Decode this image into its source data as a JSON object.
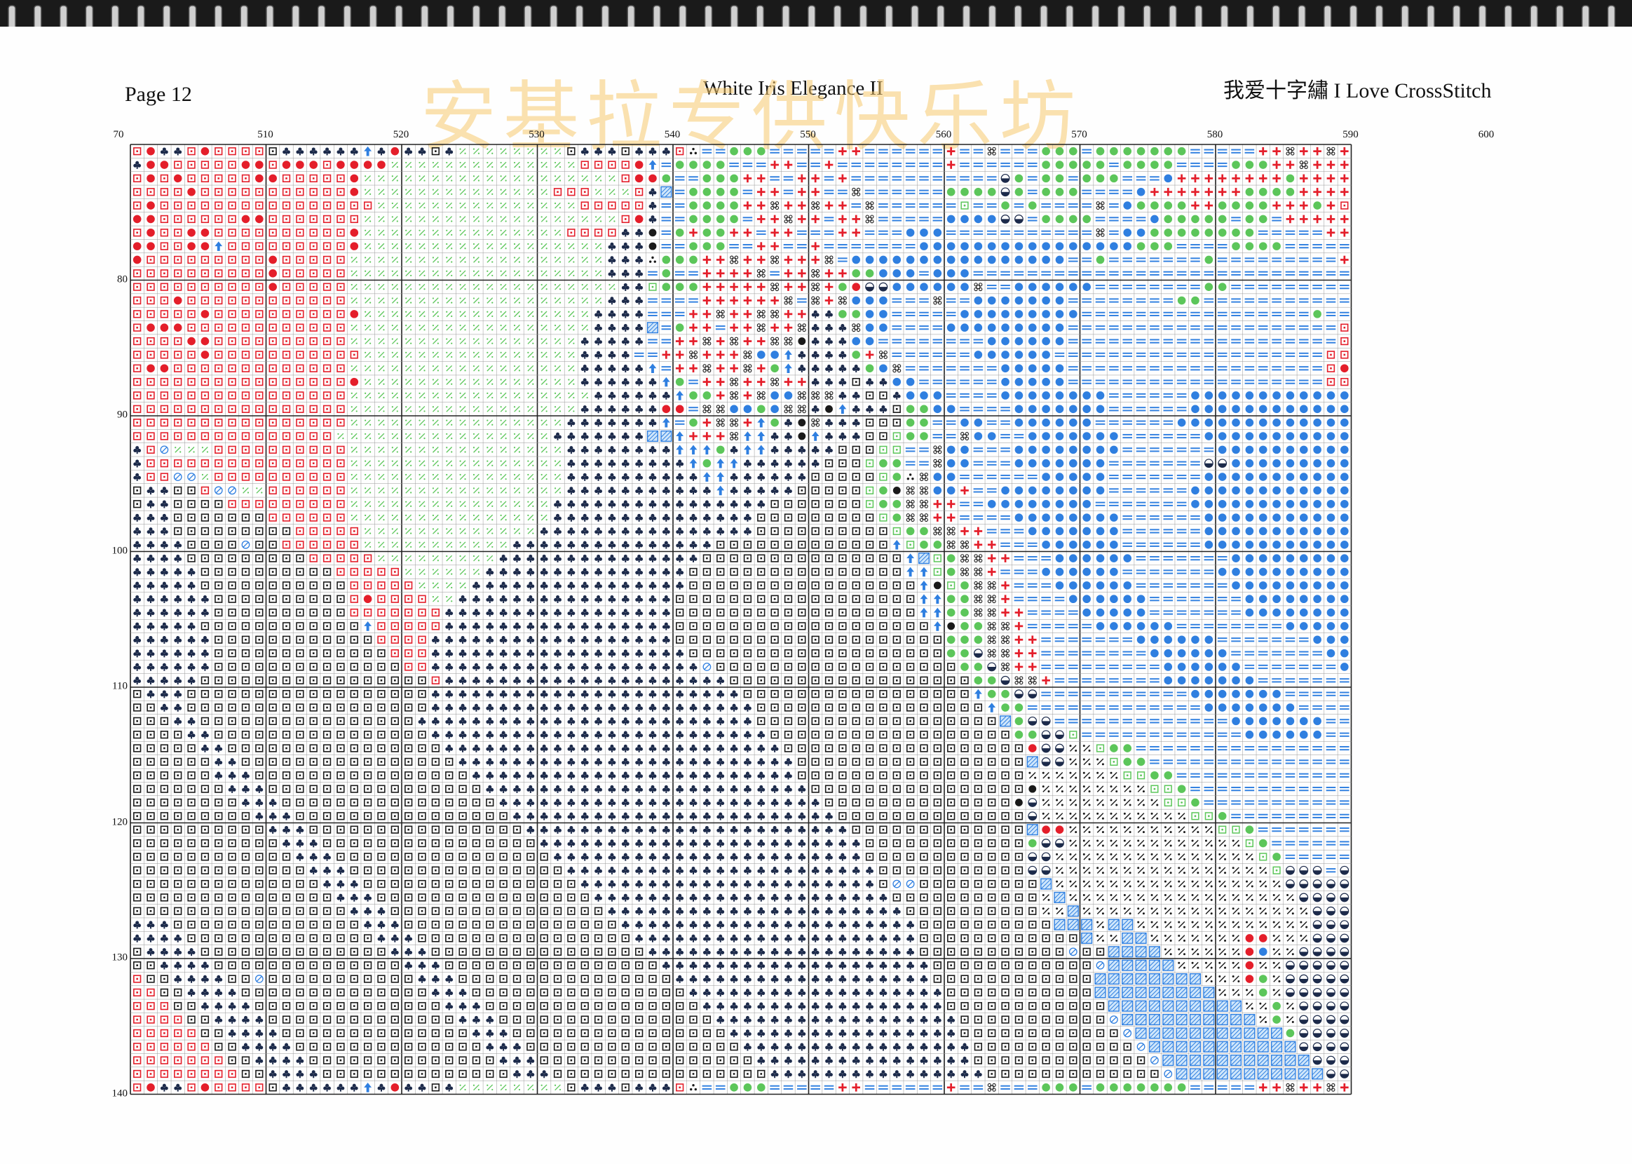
{
  "header": {
    "page_number": "Page 12",
    "title": "White Iris Elegance II",
    "publisher": "我爱十字繡 I Love CrossStitch",
    "watermark": "安基拉专供快乐坊"
  },
  "column_labels": [
    "70",
    "510",
    "520",
    "530",
    "540",
    "550",
    "560",
    "570",
    "580",
    "590",
    "600"
  ],
  "row_labels": [
    "80",
    "90",
    "100",
    "110",
    "120",
    "130",
    "140"
  ],
  "colors": {
    "red": "#e41e2a",
    "green": "#5cc65a",
    "blue": "#2f7fe0",
    "black": "#1a1a1a",
    "navy": "#1c2a4a",
    "grid_line": "#9a9a9a",
    "major_line": "#222222"
  },
  "symbol_legend": [
    {
      "code": "R",
      "icon": "red-square-dot-icon"
    },
    {
      "code": "O",
      "icon": "red-circle-icon"
    },
    {
      "code": "X",
      "icon": "green-diagonal-icon"
    },
    {
      "code": "G",
      "icon": "green-circle-icon"
    },
    {
      "code": "Q",
      "icon": "green-square-dot-icon"
    },
    {
      "code": "E",
      "icon": "blue-double-bar-icon"
    },
    {
      "code": "P",
      "icon": "red-plus-icon"
    },
    {
      "code": "K",
      "icon": "black-loop-icon"
    },
    {
      "code": "B",
      "icon": "blue-circle-icon"
    },
    {
      "code": "H",
      "icon": "blue-half-circle-icon"
    },
    {
      "code": "C",
      "icon": "black-club-icon"
    },
    {
      "code": "S",
      "icon": "black-square-dot-icon"
    },
    {
      "code": "Z",
      "icon": "black-percent-icon"
    },
    {
      "code": "A",
      "icon": "blue-arrow-icon"
    },
    {
      "code": "D",
      "icon": "black-dot-icon"
    },
    {
      "code": "T",
      "icon": "black-triple-dot-icon"
    },
    {
      "code": "N",
      "icon": "blue-hatched-square-icon"
    },
    {
      "code": "U",
      "icon": "blue-no-symbol-icon"
    }
  ],
  "grid_rows": [
    "ROCCRORRRRSCCCCCCACOCCSCXXXXXXXXSCCCSCCCRTEEGGGEEEEEPPEEEEEEPEEKEEEGGGEGGGGGGGEEEEEPPKPPKP",
    "COORRRRROOROOOROOOOXXXXXXXXXXXXXXRRRROAEGGGGEEEPPEEPEEEEEEEEPEEEEEEGGGGGEGGGGEEEEGGGPPKPPP",
    "RORORRRRROORRRRROXXXXXXXXXXXXXXXXXXXROOGEEGGGPPEEPPEPEEEEEEEEEEEHGEGGEGGGEEEBPPPPPPPPGPPPP",
    "RRRRORRRRRRRRRRROXXXXXXXXXXXXXXRRRXXXRCNEGGGGEPPEPPEEKEEEEEEGGGGHGEGGGEEEEBPPPPPPPGGGGPPPP",
    "RORRRRRRRRRRRRRRRRXXXXXXXXXXXXXXXRRRRRCEEGGGGPPKPPKPPEKEEEEEEQEEGEGEEEEKEBGGGGPPGGGGPPPGP",
    "OORRRRRROORRRRRRRXXXXXXXXXXXXXXXXXXXROCEEGGGGEPPKPPEPPKEEEEEBBBBHHEGGGGEEEEBGGGGGEGGEPPPPPP",
    "RORROORRRRRRRRRROXXXXXXXXXXXXXXXRRRRCCDEGPGGPPEPPEEEPPEEEBBBEEEEEEEEEEEKEBBGGGGGGGGEEEEEPPP",
    "OORROOARRRRRRRRROXXXXXXXXXXXXXXXXXXCCCDEEGGGEEPPEEPEEEEEEEBBBBBBBBBBBBBBBBGGGEEEEGGGGEEEEE",
    "ORRRRRRRRRORRRRRXXXXXXXXXXXXXXXXXXXCCCTGGGPPKPPKPPPKEBBBBBBBBBBBBBBBBEEGEEEEEEEGEEEEEEEEEP",
    "RRRRRRRRRRORRRRRXXXXXXXXXXXXXXXXXXXCCCEGEEPPPPKEPPKPPGGBBBEBBBEEEEEEEEEEEEEEEEEEEEEEEEEEEE",
    "RRRRRRRRRRORRRRRXXXXXXXXXXXXXXXXXXXXCCQGGGPPPPPKPPKPGOHHBBBBBBKEEBBBBBBEEEEEEEEGGEEEEEEEEE",
    "RRRORRRRRRRRRRRRXXXXXXXXXXXXXXXXXXXCCCEEEEPPPPPPKEKPKBBBEEEKEEBBBBBBBEEEEEEEEGGEEEEEEEEEEE",
    "RRRRRORRRRRRRRRROXXXXXXXXXXXXXXXXXCCCCEEEPPKPPKKPPCCGGBBEEEEEBBBBBBBBBEEEEEEEEEEEEEEEEEGEE",
    "ROOORRRRRRRRRRRRXXXXXXXXXXXXXXXXXXCCCCNEGPPEPPKPPKCCCKBBEEEEBBBBBBBBBEEEEEEEEEEEEEEEEEEEE",
    "RRRROORRRRRRRRRRXXXXXXXXXXXXXXXXXCCCCCEEPPKPKPPKKDCCCBBEEEEEEEEBBBBBBEEEEEEEEEEEEEEEEEEEE",
    "RRRRRORRRRRRRRRRRXXXXXXXXXXXXXXXXCCCCEEPPKPPPKBBACCCCGPKEEEEEEBBBBBBEEEEEEEEEEEEEEEEEEEE",
    "ROORRRRRRRRRRRRRXXXXXXXXXXXXXXXXXCCCCCAEPPKPPKPGACCCCCGBKEEEEEEEBBBBBEEEEEEEEEEEEEEEEEEE",
    "RRRRRRRRRRRRRRRROXXXXXXXXXXXXXXXXCCCCCCAGEPPKPPKPPCCCSCCBBEEEEEEBBBBBEEEEEEEEEEEEEEEEEEE",
    "RRRRRRRRRRRRRRRRXXXXXXXXXXXXXXXXXXCCCCCCAGGPKPKBBKKKCCSSCBBBEEEEBBBBBBBBEEEEEEBBBBBBBBBBBB",
    "RRRRRRRRRRRRRRRRXXXXXXXXXXXXXXXXXCCCCCCOOEKKBBGBKKCDACCCSGGBBEEEEBBBBBBBEEEEEEBBBBBBBBBBBBB",
    "RRRRRRRRRRRRRRRRXXXXXXXXXXXXXXXXCCCCCCCAEGPKKPAGCDKCCCSSSGGEEBBEEBBBBBBEEEEEEBBBBBBBBBBBBB",
    "RRRRRRRRRRRRRRRXXXXXXXXXXXXXXXXCCCCCCCNNAPPPKAACCDACCCSSQGGEEKBBEEBBBBBBBEEEEEEBBBBBBBBBBBB",
    "CRUXXXRRRRRRRRRRXXXXXXXXXXXXXXXXCCCCCCCCAAAGCAACCCCCSSSQQEEKBBEEEBBBBBBBBEEEEEEEBBBBBBBBBBB",
    "CRRRRRRRRRRRRRRRXXXXXXXXXXXXXXXXCCCCCCCCCAGAACCCCCCSSSQGGEEKBBEEEBBBBBBBEEEEEEEHHBBBBBBBBBB",
    "CRRUUXRRRRRRRRRRXXXXXXXXXXXXXXXXCCCCCCCCCCAACCCCCCSSSSSQGTKBBEEEEEEBBBBBEEEEEEEBBBBBBBBBBB",
    "SCCSSRUUXXRRRRRRXXXXXXXXXXXXXXXXCCCCCCCCCCCACCCCCSSSSSQGDKKBBPEEBBBBBBBBEEEEEEBBBBBBBBBBBBB",
    "SCCSSSSRRRRRRRRRXXXXXXXXXXXXXXXCCCCCCCCCCCCCCCCSSSSSSSQGGKKPPEEBBBBBBBBEEEEEEEBBBBBBBBBBBBB",
    "CCCSSSSSSSRRRRRRXXXXXXXXXXXXXXXCCCCCCCCCCCCCCCSSSSSSSSSQGKKPPEEEEBBBBBBBBEEEEEEBBBBBBBBBBBB",
    "CCCSSSSSSSSSRRRRRXXXXXXXXXXXXXCCCCCCCCCCCCCCCCSSSSSSSSSSQGGKKPPEEEBBBBBBBEEEEEEBBBBBBBBBBBB",
    "CCCCSSSSUSSRRRRRRXXXXXXXXXXXCCCCCCCCCCCCCCCSSSSSSSSSSSSSAQGGKKPPEEEBBBBBBEEEEEEBBBBBBBBBBBH",
    "CCCCSSSSSSSSSRRRRRXXXXXXXXXCCCCCCCCCCCCCCCSSSSSSSSSSSSSSSANQGKKPPEEEBBBBBBEEEEEEEBBBBBBBBBB",
    "CCCCCSSSSSSSSSSRRRRRXXXXXXCCCCCCCCCCCCCCCSSSSSSSSSSSSSSSSAAQGKKPEEEBBBBBBEEEEEEEBBBBBBBBBBB",
    "CCCCCSSSSSSSSSSSRRRRRXXXXCCCCCCCCCCCCCCCCSSSSSSSSSSSSSSSSSADQGKKPEEEBBBBBBEEEEEEEBBBBBBBBBB",
    "CCCCCCSSSSSSSSSSRORRRRXXCCCCCCCCCCCCCCCCSSSSSSSSSSSSSSSSSSAAGGKKPEEEEBBBBBBEEEEEEEBBBBBBBBB",
    "CCCCCCSSSSSSSSSSRRRRRRRCCCCCCCCCCCCCCCCCSSSSSSSSSSSSSSSSSSAAGGKKPPEEEEBBBBBEEEEEEEBBBBBBBBB",
    "CCCCCSSSSSSSSSSSSARRRRRCCCCCCCCCCCCCCCCCSSSSSSSSSSSSSSSSSSSADGGKKPEEEEEBBBBBBEEEEEEEEBBBBBBB",
    "CCCCCCSSSSSSSSSSSSRRRRCCCCCCCCCCCCCCCCCCSSSSSSSSSSSSSSSSSSSSGGGKKPPEEEEEEEBBBBBBEEEEEEEBBBBB",
    "CCCCCCSSSSSSSSSSSSSRRRCCCCCCCCCCCCCCCCCCCSSSSSSSSSSSSSSSSSSSGGHKKPPEEEEEEEEBBBBBBEEEEEEEBBBB",
    "CCCCCCSSSSSSSSSSSSSSRRCCCCCCCCCCCCCCCCCCCCUSSSSSSSSSSSSSSSSSSGGHKPPEEEEEEEEEBBBBBBEEEEEEEBBB",
    "CCCCCSSSSSSSSSSSSSSSSSRCCCCCCCCCCCCCCCCCCCCCSSSSSSSSSSSSSSSSSSGGHKKPEEEEEEEEBBBBBBBEEEEEEEBB",
    "SCCCSSSSSSSSSSSSSSSSSSCCCCCCCCCCCCCCCCCCCCCCCSSSSSSSSSSSSSSSSSAGGHHEEEEEEEEEEEBBBBBBBEEEEEEE",
    "SSCCSSSSSSSSSSSSSSSSSSCCCCCCCCCCCCCCCCCCCCCCCCSSSSSSSSSSSSSSSSSAGGEEEEEEEEEEEEEBBBBBBBEEEEEE",
    "SSSCCSSSSSSSSSSSSSSSSCCCCCCCCCCCCCCCCCCCCCCCCCSSSSSSSSSSSSSSSSSSNGHHEEEEEEEEEEEEEBBBBBBBEEEE",
    "SSSSCCSSSSSSSSSSSSSSSSCCCCCCCCCCCCCCCCCCCCCCCCCSSSSSSSSSSSSSSSSSSGGHHQEEEEEEEEEEEEBBBBBBEEEE",
    "SSSSSCCSSSSSSSSSSSSSSSSCCCCCCCCCCCCCCCCCCCCCCCCCSSSSSSSSSSSSSSSSSSOHHZZQGGEEEEEEEEEEEEEEEEE",
    "SSSSSSCCSSSSSSSSSSSSSSSSCCCCCCCCCCCCCCCCCCCCCCCCCSSSSSSSSSSSSSSSSSNHHZZZQGGEEEEEEEEEEEEEEEE",
    "SSSSSSCCCSSSSSSSSSSSSSSSSCCCCCCCCCCCCCCCCCCCCCCCCSSSSSSSSSSSSSSSSSZZZZZZZQQGGEEEEEEEEEEEEEEE",
    "SSSSSSSCCCSSSSSSSSSSSSSSSSCCCCCCCCCCCCCCCCCCCCCCCCSSSSSSSSSSSSSSSSDZZZZZZZZQQGEEEEEEEEEEEEEE",
    "SSSSSSSSCCCSSSSSSSSSSSSSSSSCCCCCCCCCCCCCCCCCCCCCCCCSSSSSSSSSSSSSSDHZZZZZZZZZQQGEEEEEEEEEEEEE",
    "SSSSSSSSSCCCSSSSSSSSSSSSSSSSCCCCCCCCCCCCCCCCCCCCCCCCSSSSSSSSSSSSSSHZZZZZZZZZZZQQGEEEEEEEEEEE",
    "SSSSSSSSSSCCCSSSSSSSSSSSSSSSSCCCCCCCCCCCCCCCCCCCCCCCCSSSSSSSSSSSSSNOOZZZZZZZZZZZQQGEEEEEEEEE",
    "SSSSSSSSSSSCCCSSSSSSSSSSSSSSSSCCCCCCCCCCCCCCCCCCCCCCCCSSSSSSSSSSSSGHHZZZZZZZZZZZZZQGEEEEEEEE",
    "SSSSSSSSSSSSCCCSSSSSSSSSSSSSSSSCCCCCCCCCCCCCCCCCCCCCCCSSSSSSSSSSSSHHZZZZZZZZZZZZZZZQGEEEEEEH",
    "SSSSSSSSSSSSSCCCSSSSSSSSSSSSSSSSCCCCCCCCCCCCCCCCCCCCCCCSSSSSSSSSSSHHZZZZZZZZZZZZZZZZQHHHEHHH",
    "SSSSSSSSSSSSSSCCCSSSSSSSSSSSSSSSSCCCCCCCCCCCCCCCCCCCCCCSUUSSSSSSSSSNZZZZZZZZZZZZZZZZZHHHHHHH",
    "SSSSSSSSSSSSSSSCCCSSSSSSSSSSSSSSSSCCCCCCCCCCCCCCCCCCCCCCSSSSSSSSSSSZNZZZZZZZZZZZZZZZZZHHHHHH",
    "SSSSSSSSSSSSSSSSCCCSSSSSSSSSSSSSSSSCCCCCCCCCCCCCCCCCCCCCCSSSSSSSSSSZZNZZZZZZZZZZZZZZZZZHHHHH",
    "CCCSSSSSSSSSSSSSSCCCSSSSSSSSSSSSSSSSCCCCCCCCCCCCCCCCCCCCCCSSSSSSSSSSNNNZNNZZZZZZZZZZZZZHHHHH",
    "CCCCSSSSSSSSSSSSSSCCCSSSSSSSSSSSSSSSSCCCCCCCCCCCCCCCCCCCCCSSSSSSSSSSSSNZZNNZZZZZZZOOZZZHHHHH",
    "SCCCCSSSSSSSSSSSSSSCCCSSSSSSSSSSSSSSSSCCCCCCCCCCCCCCCCCCCCSSSSSSSSSSSUSSNNNNZZZZZZOBZZHHHHH",
    "SSCCCCSSSSSSSSSSSSSSCCCSSSSSSSSSSSSSSSSCCCCCCCCCCCCCCCCCCCCSSSSSSSSSSSSUNNNNNZZZZZOZZHHHHHH",
    "RSSCCCCSSUSSSSSSSSSSSCCCSSSSSSSSSSSSSSSSCCCCCCCCCCCCCCCCCCCSSSSSSSSSSSSNNNNNNNNZZZOGZHHHHHH",
    "RRSSCCCCSSSSSSSSSSSSSSCCCSSSSSSSSSSSSSSSSCCCCCCCCCCCCCCCCCCCSSSSSSSSSSSNNNNNNNNNZZZGZHHHHHH",
    "RRRSSCCCCSSSSSSSSSSSSSSCCCSSSSSSSSSSSSSSSSCCCCCCCCCCCCCCCCCCSSSSSSSSSSSSNNNNNNNNNNZZGZHHHHH",
    "RRRRSSCCCCSSSSSSSSSSSSSSCCCSSSSSSSSSSSSSSSSCCCCCCCCCCCCCCCCCCSSSSSSSSSSSUNNNNNNNNNNZGZHHHHH",
    "RRRRRSSCCCCSSSSSSSSSSSSSSCCCSSSSSSSSSSSSSSSSCCCCCCCCCCCCCCCCCSSSSSSSSSSSSUNNNNNNNNNNNGHHHHH",
    "RRRRRRSSCCCCSSSSSSSSSSSSSSCCCSSSSSSSSSSSSSSSSCCCCCCCCCCCCCCCCCSSSSSSSSSSSSUNNNNNNNNNNNHHHHH",
    "RRRRRRRSSCCCCSSSSSSSSSSSSSSCCCSSSSSSSSSSSSSSSSCCCCCCCCCCCCCCCCSSSSSSSSSSSSSUNNNNNNNNNNNHHHH",
    "RRRRRRRRSSCCCCSSSSSSSSSSSSSSCCCSSSSSSSSSSSSSSSSCCCCCCCCCCCCCCCCSSSSSSSSSSSSSUNNNNNNNNNNNHHH"
  ]
}
